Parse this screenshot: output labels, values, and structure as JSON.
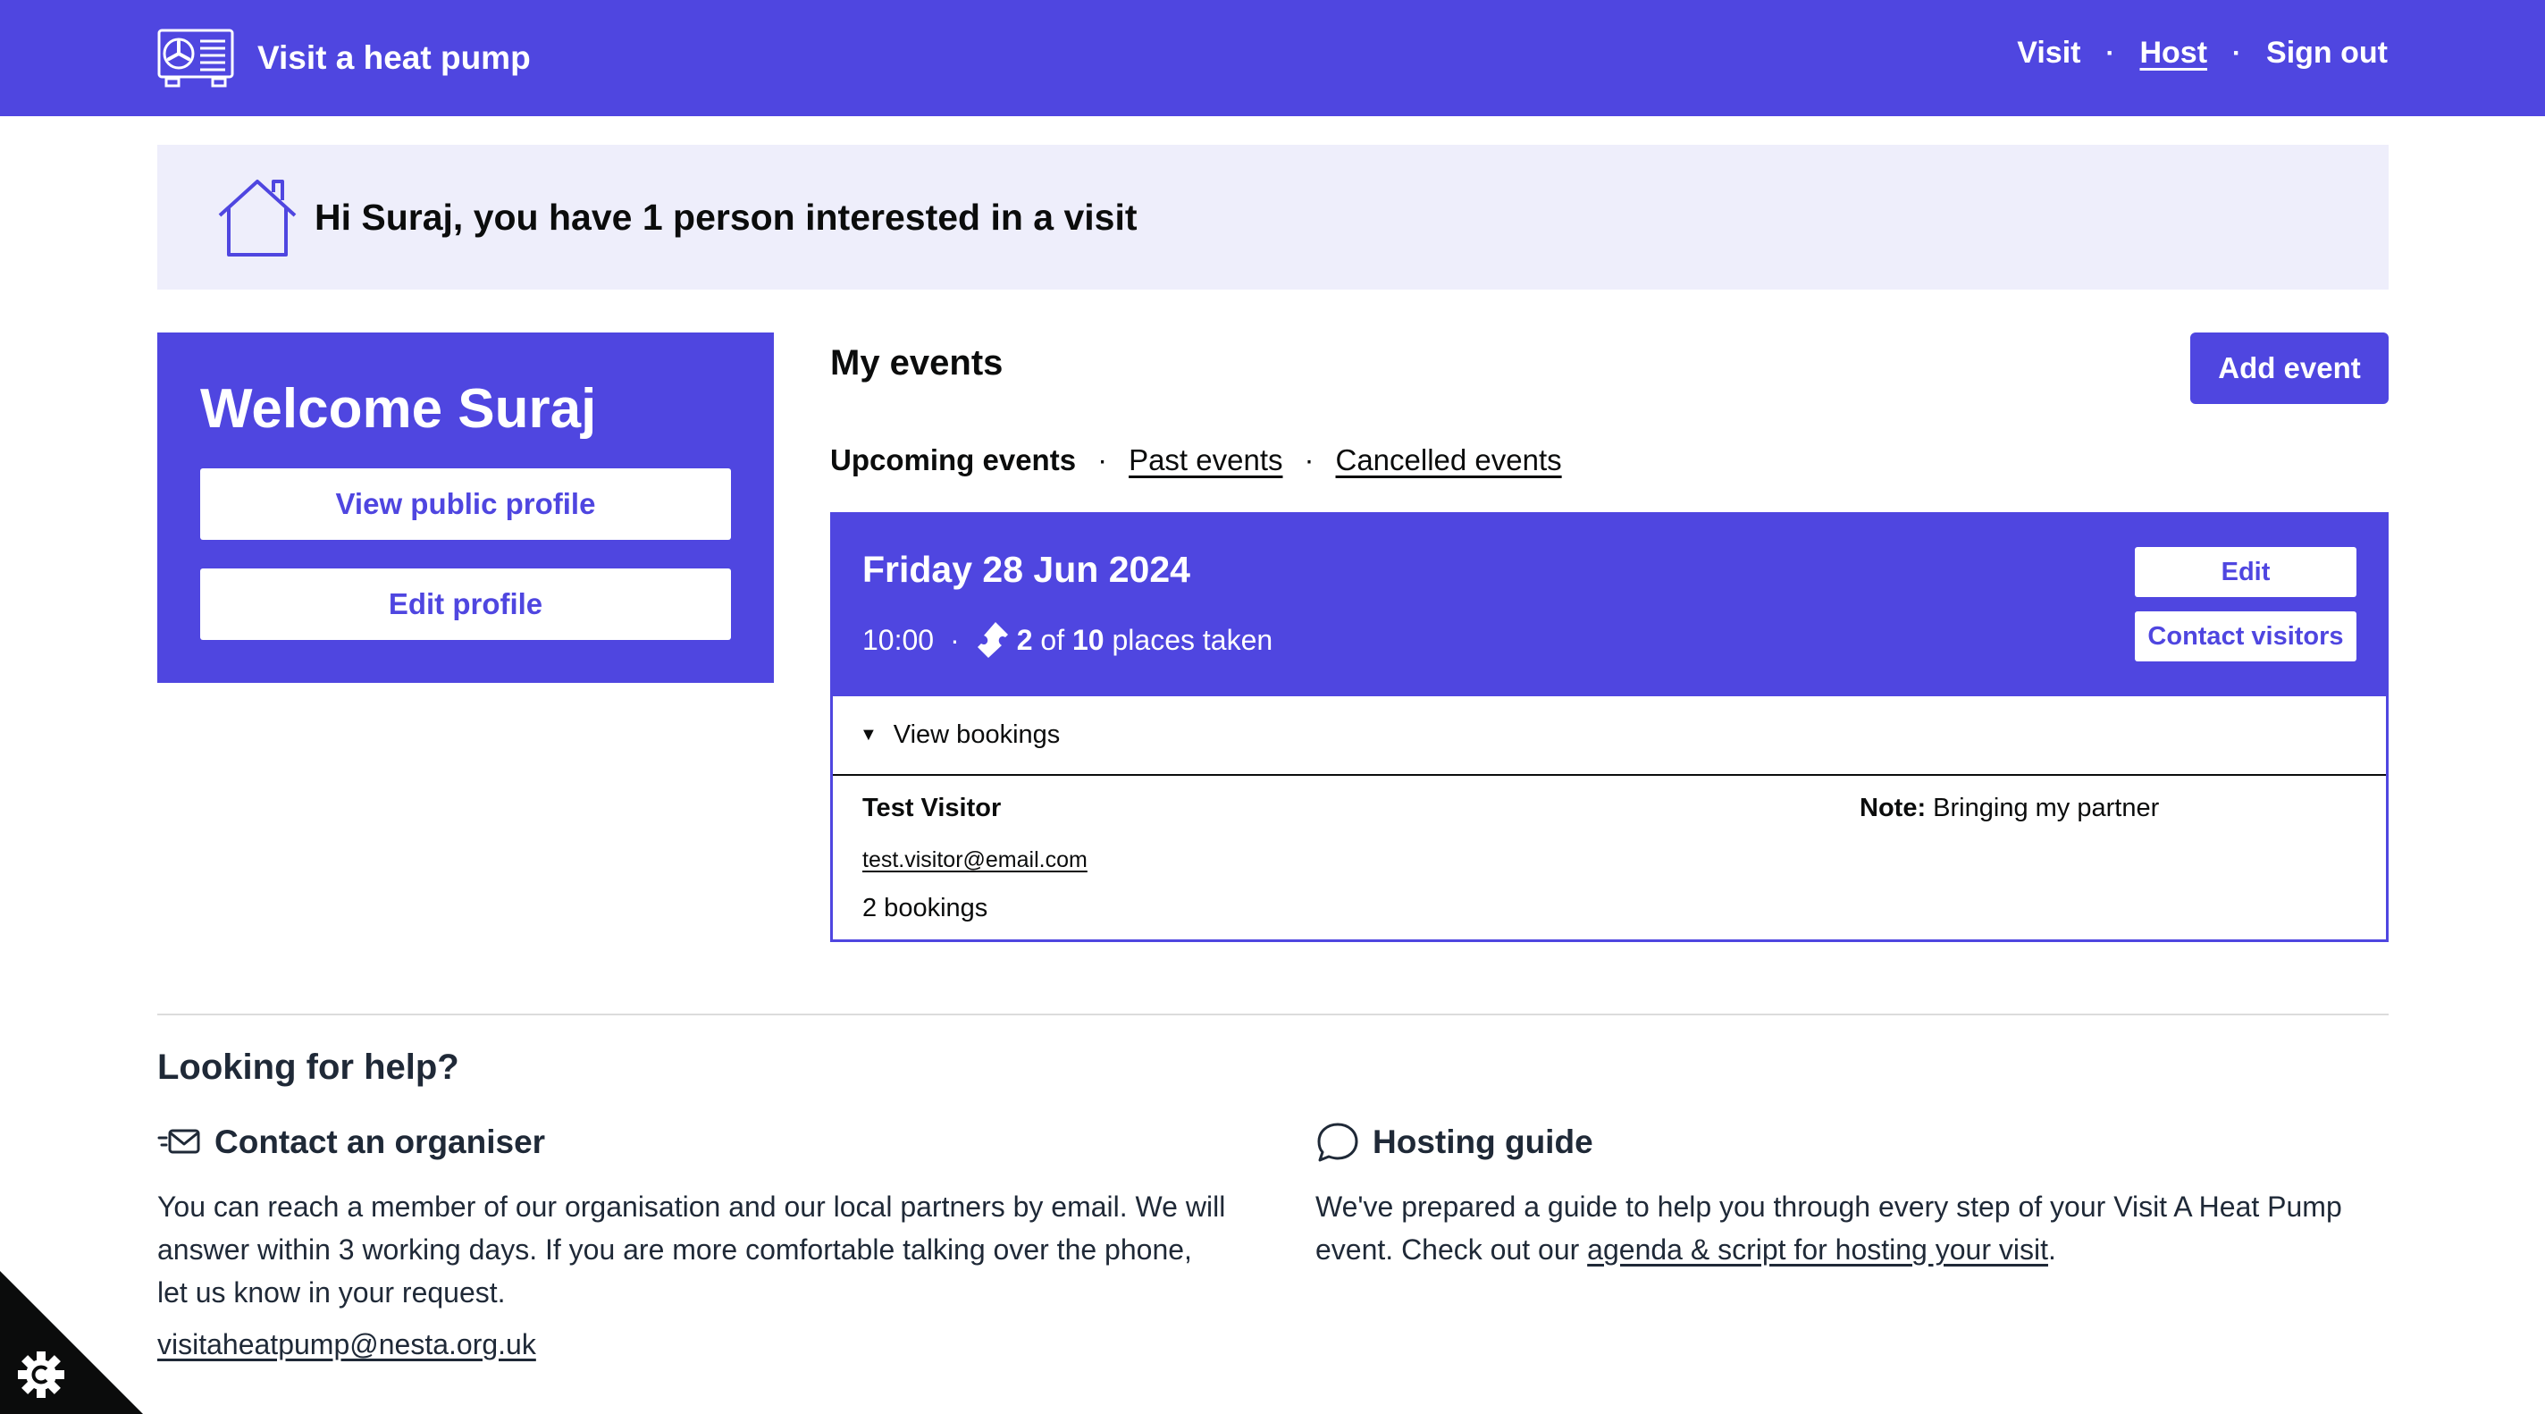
{
  "header": {
    "brand_name": "Visit a heat pump",
    "nav": [
      {
        "label": "Visit"
      },
      {
        "label": "Host"
      },
      {
        "label": "Sign out"
      }
    ],
    "separator": "·"
  },
  "banner": {
    "message": "Hi Suraj, you have 1 person interested in a visit"
  },
  "welcome": {
    "title": "Welcome Suraj",
    "view_profile_label": "View public profile",
    "edit_profile_label": "Edit profile"
  },
  "events": {
    "title": "My events",
    "add_event_label": "Add event",
    "filters": {
      "upcoming": "Upcoming events",
      "past": "Past events",
      "cancelled": "Cancelled events"
    },
    "card": {
      "date": "Friday 28 Jun 2024",
      "time": "10:00",
      "taken": "2",
      "of_text": "of",
      "capacity": "10",
      "places_text": "places taken",
      "edit_label": "Edit",
      "contact_label": "Contact visitors",
      "toggle_label": "View bookings",
      "booking": {
        "name": "Test Visitor",
        "email": "test.visitor@email.com",
        "count": "2 bookings",
        "note_label": "Note:",
        "note_text": "Bringing my partner"
      }
    }
  },
  "help": {
    "title": "Looking for help?",
    "contact": {
      "heading": "Contact an organiser",
      "body": "You can reach a member of our organisation and our local partners by email. We will answer within 3 working days. If you are more comfortable talking over the phone, let us know in your request.",
      "email": "visitaheatpump@nesta.org.uk"
    },
    "guide": {
      "heading": "Hosting guide",
      "body_before": "We've prepared a guide to help you through every step of your Visit A Heat Pump event. Check out our",
      "link_text": "agenda & script for hosting your visit",
      "body_after": "."
    }
  },
  "colors": {
    "brand": "#4f46e0",
    "banner_bg": "#eeeefb",
    "text": "#0b0c0c"
  },
  "icons": {
    "brand": "heat-pump-icon",
    "banner": "house-icon",
    "ticket": "ticket-icon",
    "contact": "envelope-icon",
    "guide": "speech-bubble-icon",
    "corner": "settings-gear-icon"
  }
}
